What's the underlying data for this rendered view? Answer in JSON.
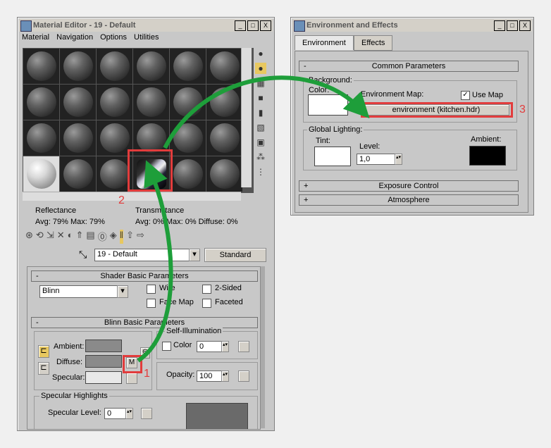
{
  "material_editor": {
    "title": "Material Editor - 19 - Default",
    "window_buttons": [
      "_",
      "□",
      "X"
    ],
    "menu": [
      "Material",
      "Navigation",
      "Options",
      "Utilities"
    ],
    "stats": {
      "reflectance_label": "Reflectance",
      "reflectance_values": "Avg:  79% Max:  79%",
      "transmittance_label": "Transmittance",
      "transmittance_values": "Avg:    0% Max:    0%  Diffuse:    0%"
    },
    "material_name": "19 - Default",
    "material_type": "Standard",
    "shader_rollout": {
      "title": "Shader Basic Parameters",
      "shader": "Blinn",
      "wire": "Wire",
      "two_sided": "2-Sided",
      "face_map": "Face Map",
      "faceted": "Faceted"
    },
    "blinn_rollout": {
      "title": "Blinn Basic Parameters",
      "self_illum": "Self-Illumination",
      "color": "Color",
      "color_value": "0",
      "ambient": "Ambient:",
      "diffuse": "Diffuse:",
      "specular": "Specular:",
      "map_button": "M",
      "opacity": "Opacity:",
      "opacity_value": "100",
      "spec_highlights": "Specular Highlights",
      "spec_level": "Specular Level:",
      "spec_level_value": "0"
    }
  },
  "environment": {
    "title": "Environment and Effects",
    "window_buttons": [
      "_",
      "□",
      "X"
    ],
    "tabs": [
      "Environment",
      "Effects"
    ],
    "common_params": "Common Parameters",
    "background_label": "Background:",
    "color_label": "Color:",
    "env_map_label": "Environment Map:",
    "use_map": "Use Map",
    "env_map_value": "environment (kitchen.hdr)",
    "global_lighting": "Global Lighting:",
    "tint": "Tint:",
    "level": "Level:",
    "level_value": "1,0",
    "ambient": "Ambient:",
    "exposure_control": "Exposure Control",
    "atmosphere": "Atmosphere"
  },
  "annotations": {
    "step1": "1",
    "step2": "2",
    "step3": "3"
  },
  "colors": {
    "annotation_red": "#e23c3c",
    "arrow_green": "#1e9e3a"
  }
}
